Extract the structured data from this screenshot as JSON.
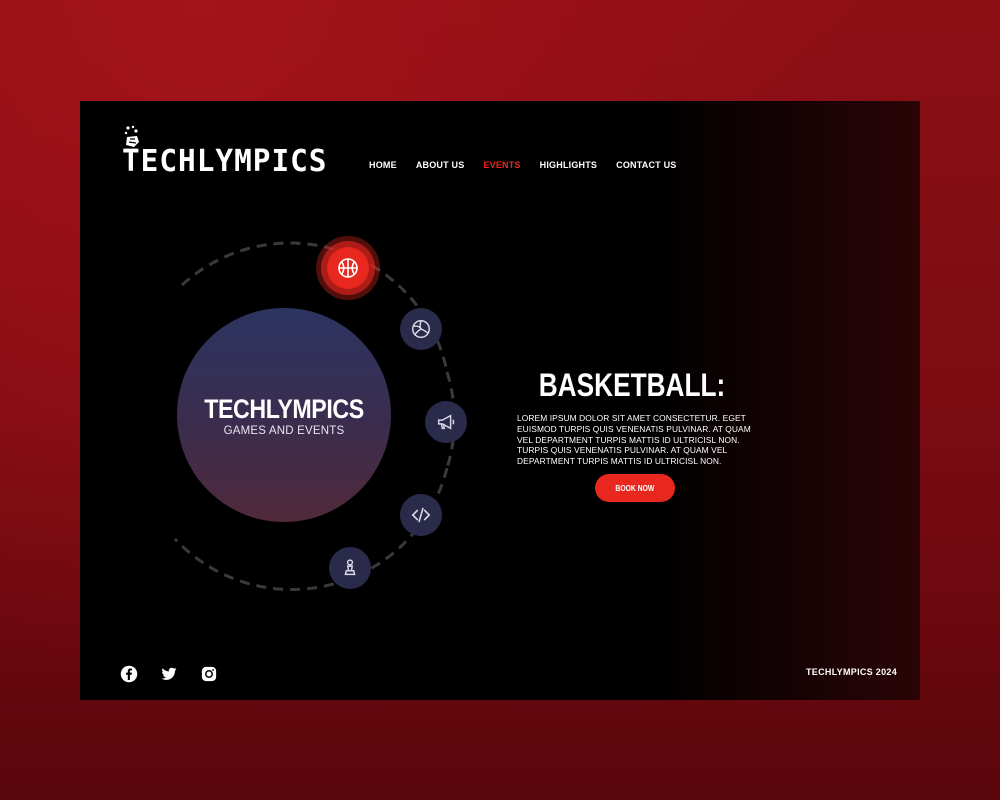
{
  "brand": {
    "name": "TECHLYMPICS"
  },
  "nav": {
    "items": [
      {
        "label": "HOME"
      },
      {
        "label": "ABOUT US"
      },
      {
        "label": "EVENTS",
        "active": true
      },
      {
        "label": "HIGHLIGHTS"
      },
      {
        "label": "CONTACT US"
      }
    ]
  },
  "hub": {
    "title": "TECHLYMPICS",
    "subtitle": "GAMES AND EVENTS"
  },
  "events": [
    {
      "icon": "basketball-icon",
      "active": true
    },
    {
      "icon": "volleyball-icon"
    },
    {
      "icon": "megaphone-icon"
    },
    {
      "icon": "code-icon"
    },
    {
      "icon": "chess-pawn-icon"
    }
  ],
  "event_detail": {
    "title": "BASKETBALL:",
    "description": "LOREM IPSUM DOLOR SIT AMET CONSECTETUR. EGET EUISMOD TURPIS QUIS VENENATIS PULVINAR. AT QUAM VEL DEPARTMENT TURPIS MATTIS ID ULTRICISL NON. TURPIS QUIS VENENATIS PULVINAR. AT QUAM VEL DEPARTMENT TURPIS MATTIS ID ULTRICISL NON.",
    "button_label": "BOOK NOW"
  },
  "footer": {
    "socials": [
      {
        "icon": "facebook-icon"
      },
      {
        "icon": "twitter-icon"
      },
      {
        "icon": "instagram-icon"
      }
    ],
    "copyright": "TECHLYMPICS 2024"
  },
  "colors": {
    "accent": "#e8281e",
    "background": "#000000",
    "hub_gradient_top": "#2c3460",
    "hub_gradient_bottom": "#51293a",
    "orb": "#2a2a4a",
    "page_backdrop": "#8d0f16"
  }
}
